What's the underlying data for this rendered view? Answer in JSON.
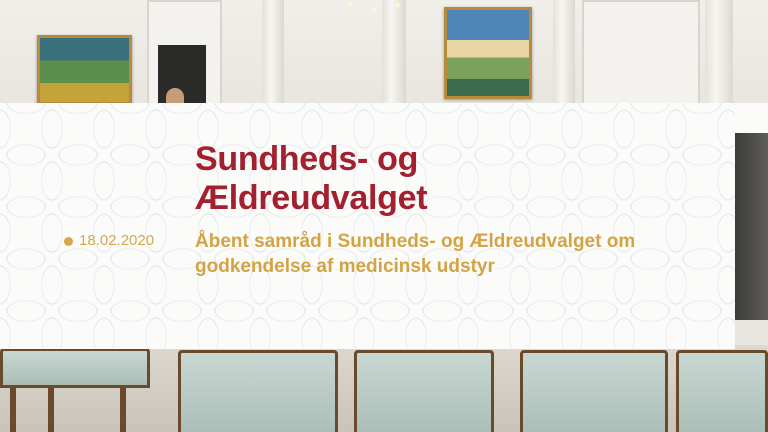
{
  "overlay": {
    "title_line1": "Sundheds- og",
    "title_line2": "Ældreudvalget",
    "date": "18.02.2020",
    "subtitle_line1": "Åbent samråd i Sundheds- og Ældreudvalget om",
    "subtitle_line2": "godkendelse af medicinsk udstyr"
  },
  "colors": {
    "title": "#a3202f",
    "accent_gold": "#d3a443",
    "card_background": "#fbfbfa"
  }
}
